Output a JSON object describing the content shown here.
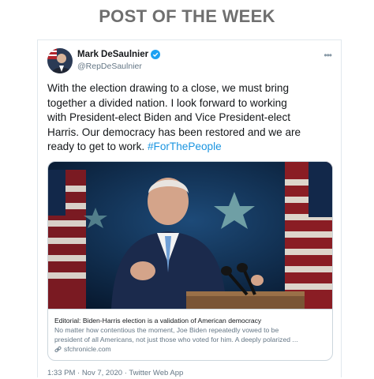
{
  "heading": "POST OF THE WEEK",
  "tweet": {
    "author_name": "Mark DeSaulnier",
    "author_handle": "@RepDeSaulnier",
    "more_glyph": "•••",
    "text_lines": [
      "With the election drawing to a close, we must bring",
      "together a divided nation. I look forward to working",
      "with President-elect Biden and Vice President-elect",
      "Harris. Our democracy has been restored and we are",
      "ready to get to work."
    ],
    "hashtag": "#ForThePeople",
    "link": {
      "title": "Editorial: Biden-Harris election is a validation of American democracy",
      "description_lines": [
        "No matter how contentious the moment, Joe Biden repeatedly vowed to be",
        "president of all Americans, not just those who voted for him. A deeply polarized ..."
      ],
      "domain": "sfchronicle.com"
    },
    "timestamp": "1:33 PM · Nov 7, 2020 · Twitter Web App"
  },
  "colors": {
    "heading": "#6f6f6f",
    "link_blue": "#1b95e0",
    "verified": "#1da1f2",
    "secondary_text": "#657786",
    "photo_background": "#0e2a4a"
  },
  "icons": {
    "verified": "verified-badge-icon",
    "more": "more-options-icon",
    "link": "link-icon"
  }
}
